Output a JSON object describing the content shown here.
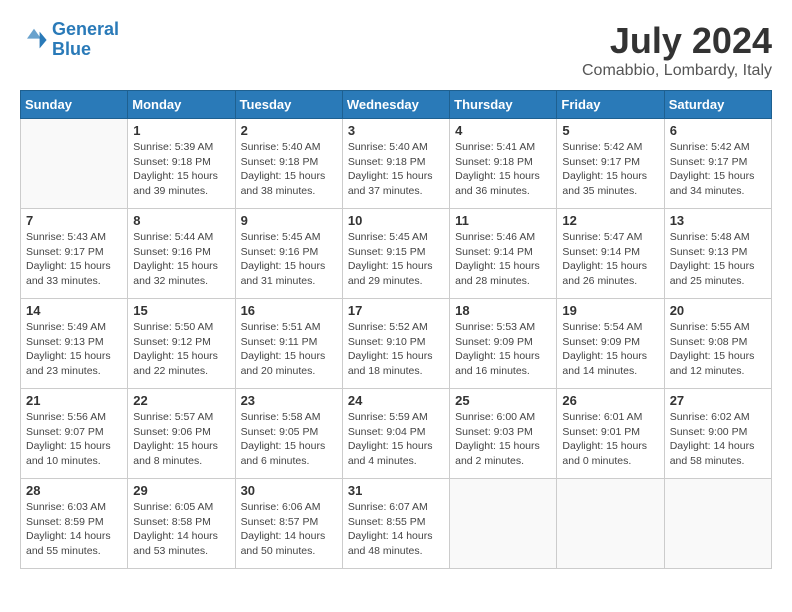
{
  "header": {
    "logo_line1": "General",
    "logo_line2": "Blue",
    "title": "July 2024",
    "location": "Comabbio, Lombardy, Italy"
  },
  "columns": [
    "Sunday",
    "Monday",
    "Tuesday",
    "Wednesday",
    "Thursday",
    "Friday",
    "Saturday"
  ],
  "weeks": [
    [
      {
        "day": "",
        "info": ""
      },
      {
        "day": "1",
        "info": "Sunrise: 5:39 AM\nSunset: 9:18 PM\nDaylight: 15 hours\nand 39 minutes."
      },
      {
        "day": "2",
        "info": "Sunrise: 5:40 AM\nSunset: 9:18 PM\nDaylight: 15 hours\nand 38 minutes."
      },
      {
        "day": "3",
        "info": "Sunrise: 5:40 AM\nSunset: 9:18 PM\nDaylight: 15 hours\nand 37 minutes."
      },
      {
        "day": "4",
        "info": "Sunrise: 5:41 AM\nSunset: 9:18 PM\nDaylight: 15 hours\nand 36 minutes."
      },
      {
        "day": "5",
        "info": "Sunrise: 5:42 AM\nSunset: 9:17 PM\nDaylight: 15 hours\nand 35 minutes."
      },
      {
        "day": "6",
        "info": "Sunrise: 5:42 AM\nSunset: 9:17 PM\nDaylight: 15 hours\nand 34 minutes."
      }
    ],
    [
      {
        "day": "7",
        "info": "Sunrise: 5:43 AM\nSunset: 9:17 PM\nDaylight: 15 hours\nand 33 minutes."
      },
      {
        "day": "8",
        "info": "Sunrise: 5:44 AM\nSunset: 9:16 PM\nDaylight: 15 hours\nand 32 minutes."
      },
      {
        "day": "9",
        "info": "Sunrise: 5:45 AM\nSunset: 9:16 PM\nDaylight: 15 hours\nand 31 minutes."
      },
      {
        "day": "10",
        "info": "Sunrise: 5:45 AM\nSunset: 9:15 PM\nDaylight: 15 hours\nand 29 minutes."
      },
      {
        "day": "11",
        "info": "Sunrise: 5:46 AM\nSunset: 9:14 PM\nDaylight: 15 hours\nand 28 minutes."
      },
      {
        "day": "12",
        "info": "Sunrise: 5:47 AM\nSunset: 9:14 PM\nDaylight: 15 hours\nand 26 minutes."
      },
      {
        "day": "13",
        "info": "Sunrise: 5:48 AM\nSunset: 9:13 PM\nDaylight: 15 hours\nand 25 minutes."
      }
    ],
    [
      {
        "day": "14",
        "info": "Sunrise: 5:49 AM\nSunset: 9:13 PM\nDaylight: 15 hours\nand 23 minutes."
      },
      {
        "day": "15",
        "info": "Sunrise: 5:50 AM\nSunset: 9:12 PM\nDaylight: 15 hours\nand 22 minutes."
      },
      {
        "day": "16",
        "info": "Sunrise: 5:51 AM\nSunset: 9:11 PM\nDaylight: 15 hours\nand 20 minutes."
      },
      {
        "day": "17",
        "info": "Sunrise: 5:52 AM\nSunset: 9:10 PM\nDaylight: 15 hours\nand 18 minutes."
      },
      {
        "day": "18",
        "info": "Sunrise: 5:53 AM\nSunset: 9:09 PM\nDaylight: 15 hours\nand 16 minutes."
      },
      {
        "day": "19",
        "info": "Sunrise: 5:54 AM\nSunset: 9:09 PM\nDaylight: 15 hours\nand 14 minutes."
      },
      {
        "day": "20",
        "info": "Sunrise: 5:55 AM\nSunset: 9:08 PM\nDaylight: 15 hours\nand 12 minutes."
      }
    ],
    [
      {
        "day": "21",
        "info": "Sunrise: 5:56 AM\nSunset: 9:07 PM\nDaylight: 15 hours\nand 10 minutes."
      },
      {
        "day": "22",
        "info": "Sunrise: 5:57 AM\nSunset: 9:06 PM\nDaylight: 15 hours\nand 8 minutes."
      },
      {
        "day": "23",
        "info": "Sunrise: 5:58 AM\nSunset: 9:05 PM\nDaylight: 15 hours\nand 6 minutes."
      },
      {
        "day": "24",
        "info": "Sunrise: 5:59 AM\nSunset: 9:04 PM\nDaylight: 15 hours\nand 4 minutes."
      },
      {
        "day": "25",
        "info": "Sunrise: 6:00 AM\nSunset: 9:03 PM\nDaylight: 15 hours\nand 2 minutes."
      },
      {
        "day": "26",
        "info": "Sunrise: 6:01 AM\nSunset: 9:01 PM\nDaylight: 15 hours\nand 0 minutes."
      },
      {
        "day": "27",
        "info": "Sunrise: 6:02 AM\nSunset: 9:00 PM\nDaylight: 14 hours\nand 58 minutes."
      }
    ],
    [
      {
        "day": "28",
        "info": "Sunrise: 6:03 AM\nSunset: 8:59 PM\nDaylight: 14 hours\nand 55 minutes."
      },
      {
        "day": "29",
        "info": "Sunrise: 6:05 AM\nSunset: 8:58 PM\nDaylight: 14 hours\nand 53 minutes."
      },
      {
        "day": "30",
        "info": "Sunrise: 6:06 AM\nSunset: 8:57 PM\nDaylight: 14 hours\nand 50 minutes."
      },
      {
        "day": "31",
        "info": "Sunrise: 6:07 AM\nSunset: 8:55 PM\nDaylight: 14 hours\nand 48 minutes."
      },
      {
        "day": "",
        "info": ""
      },
      {
        "day": "",
        "info": ""
      },
      {
        "day": "",
        "info": ""
      }
    ]
  ]
}
